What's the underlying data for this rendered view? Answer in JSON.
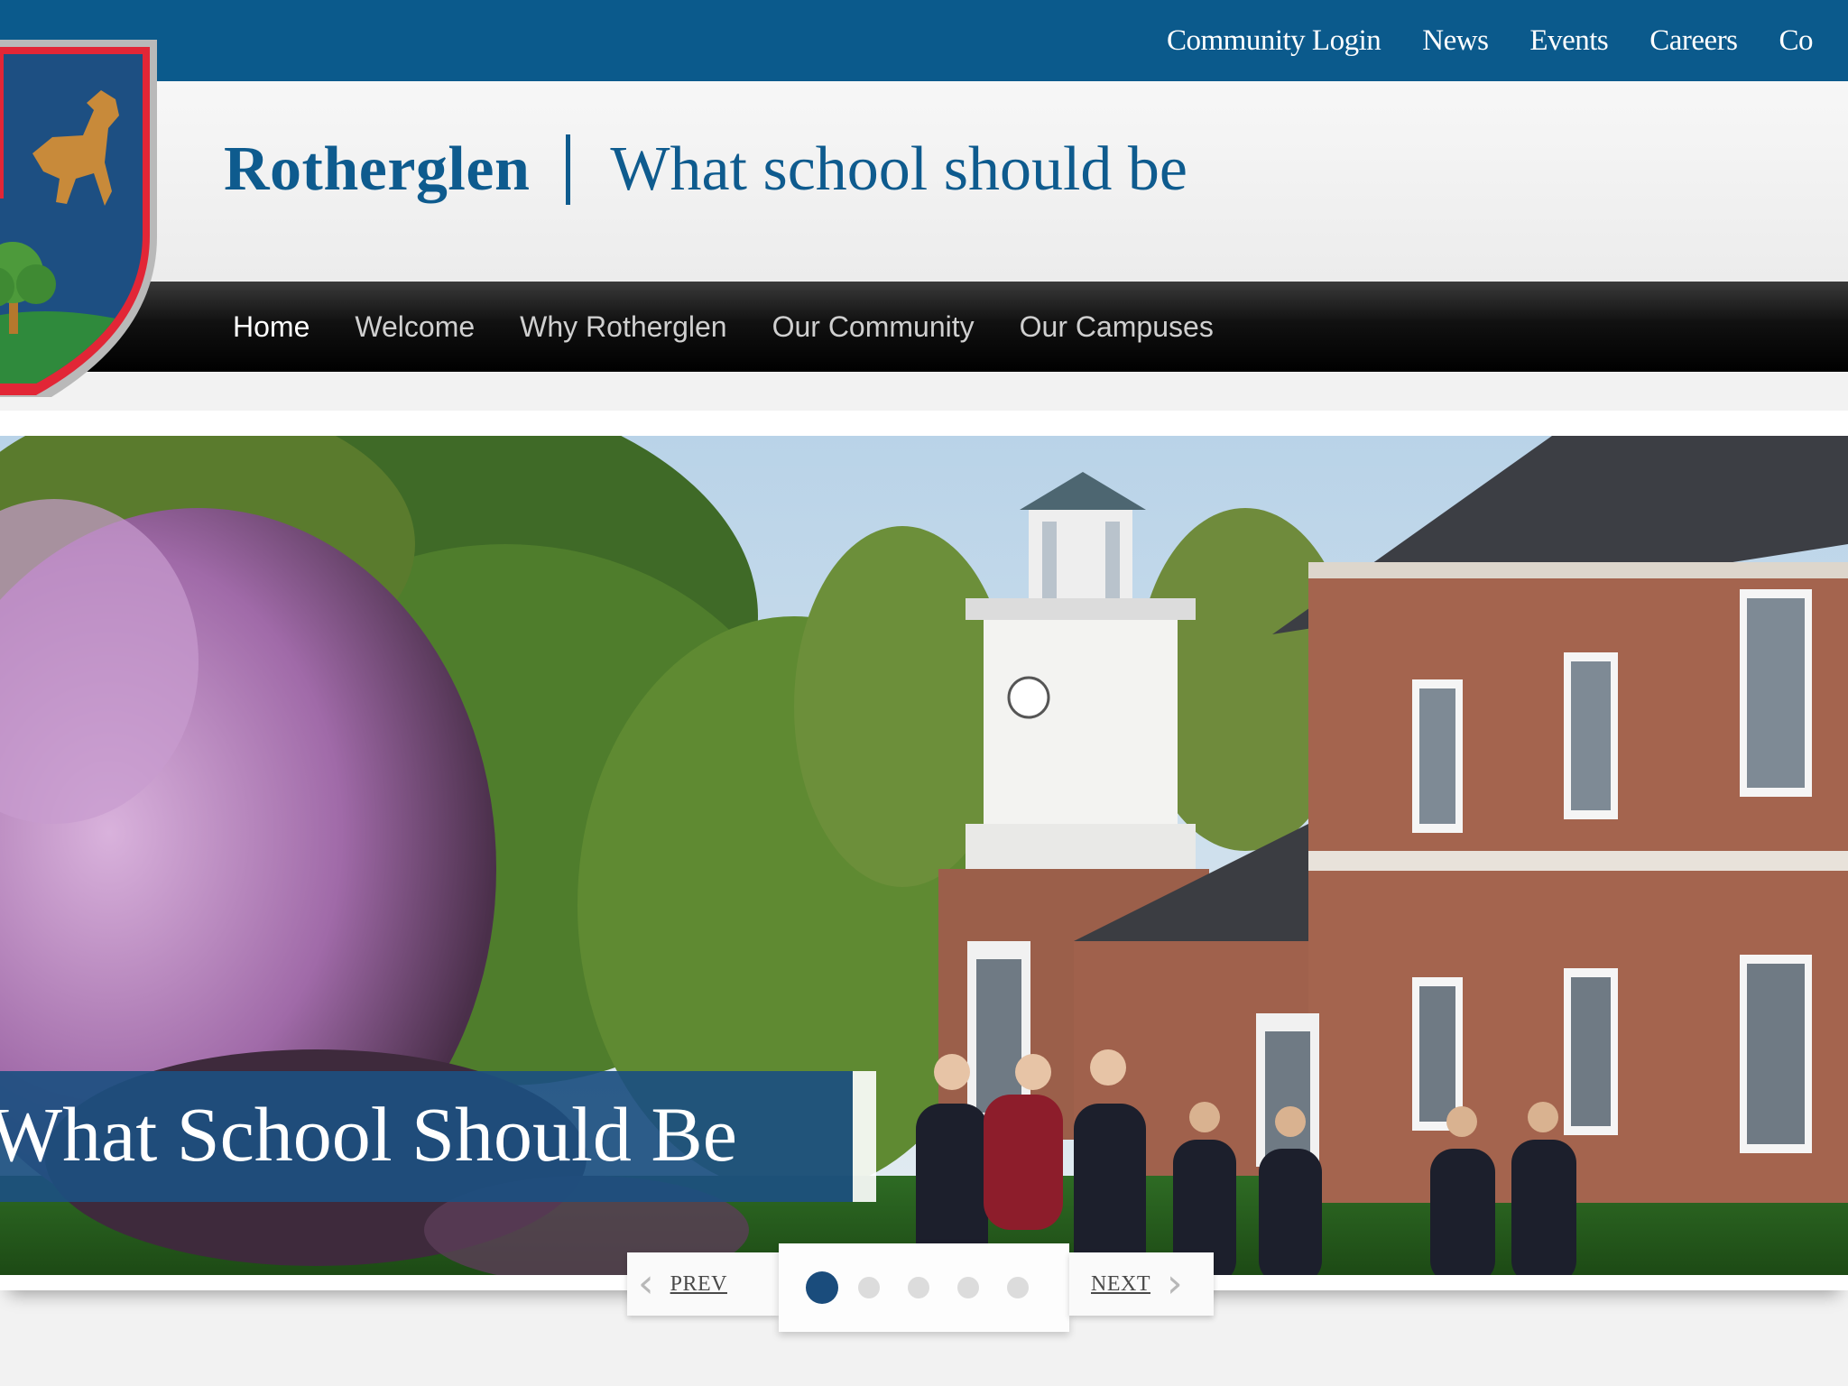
{
  "utility_nav": {
    "items": [
      {
        "label": "Community Login"
      },
      {
        "label": "News"
      },
      {
        "label": "Events"
      },
      {
        "label": "Careers"
      },
      {
        "label": "Co"
      }
    ]
  },
  "brand": {
    "name": "Rotherglen",
    "divider": "|",
    "tagline": "What school should be"
  },
  "main_nav": {
    "items": [
      {
        "label": "Home",
        "active": true
      },
      {
        "label": "Welcome"
      },
      {
        "label": "Why Rotherglen"
      },
      {
        "label": "Our Community"
      },
      {
        "label": "Our Campuses"
      }
    ]
  },
  "hero": {
    "caption": "What School Should Be",
    "slide_count": 5,
    "active_slide": 1
  },
  "slider": {
    "prev_label": "PREV",
    "next_label": "NEXT",
    "prev_icon": "chevron-left-icon",
    "next_icon": "chevron-right-icon"
  },
  "colors": {
    "topbar": "#0b5a8c",
    "brand_text": "#0e5b8e",
    "caption_bg": "#1c4f80",
    "active_dot": "#1a4c7c"
  }
}
